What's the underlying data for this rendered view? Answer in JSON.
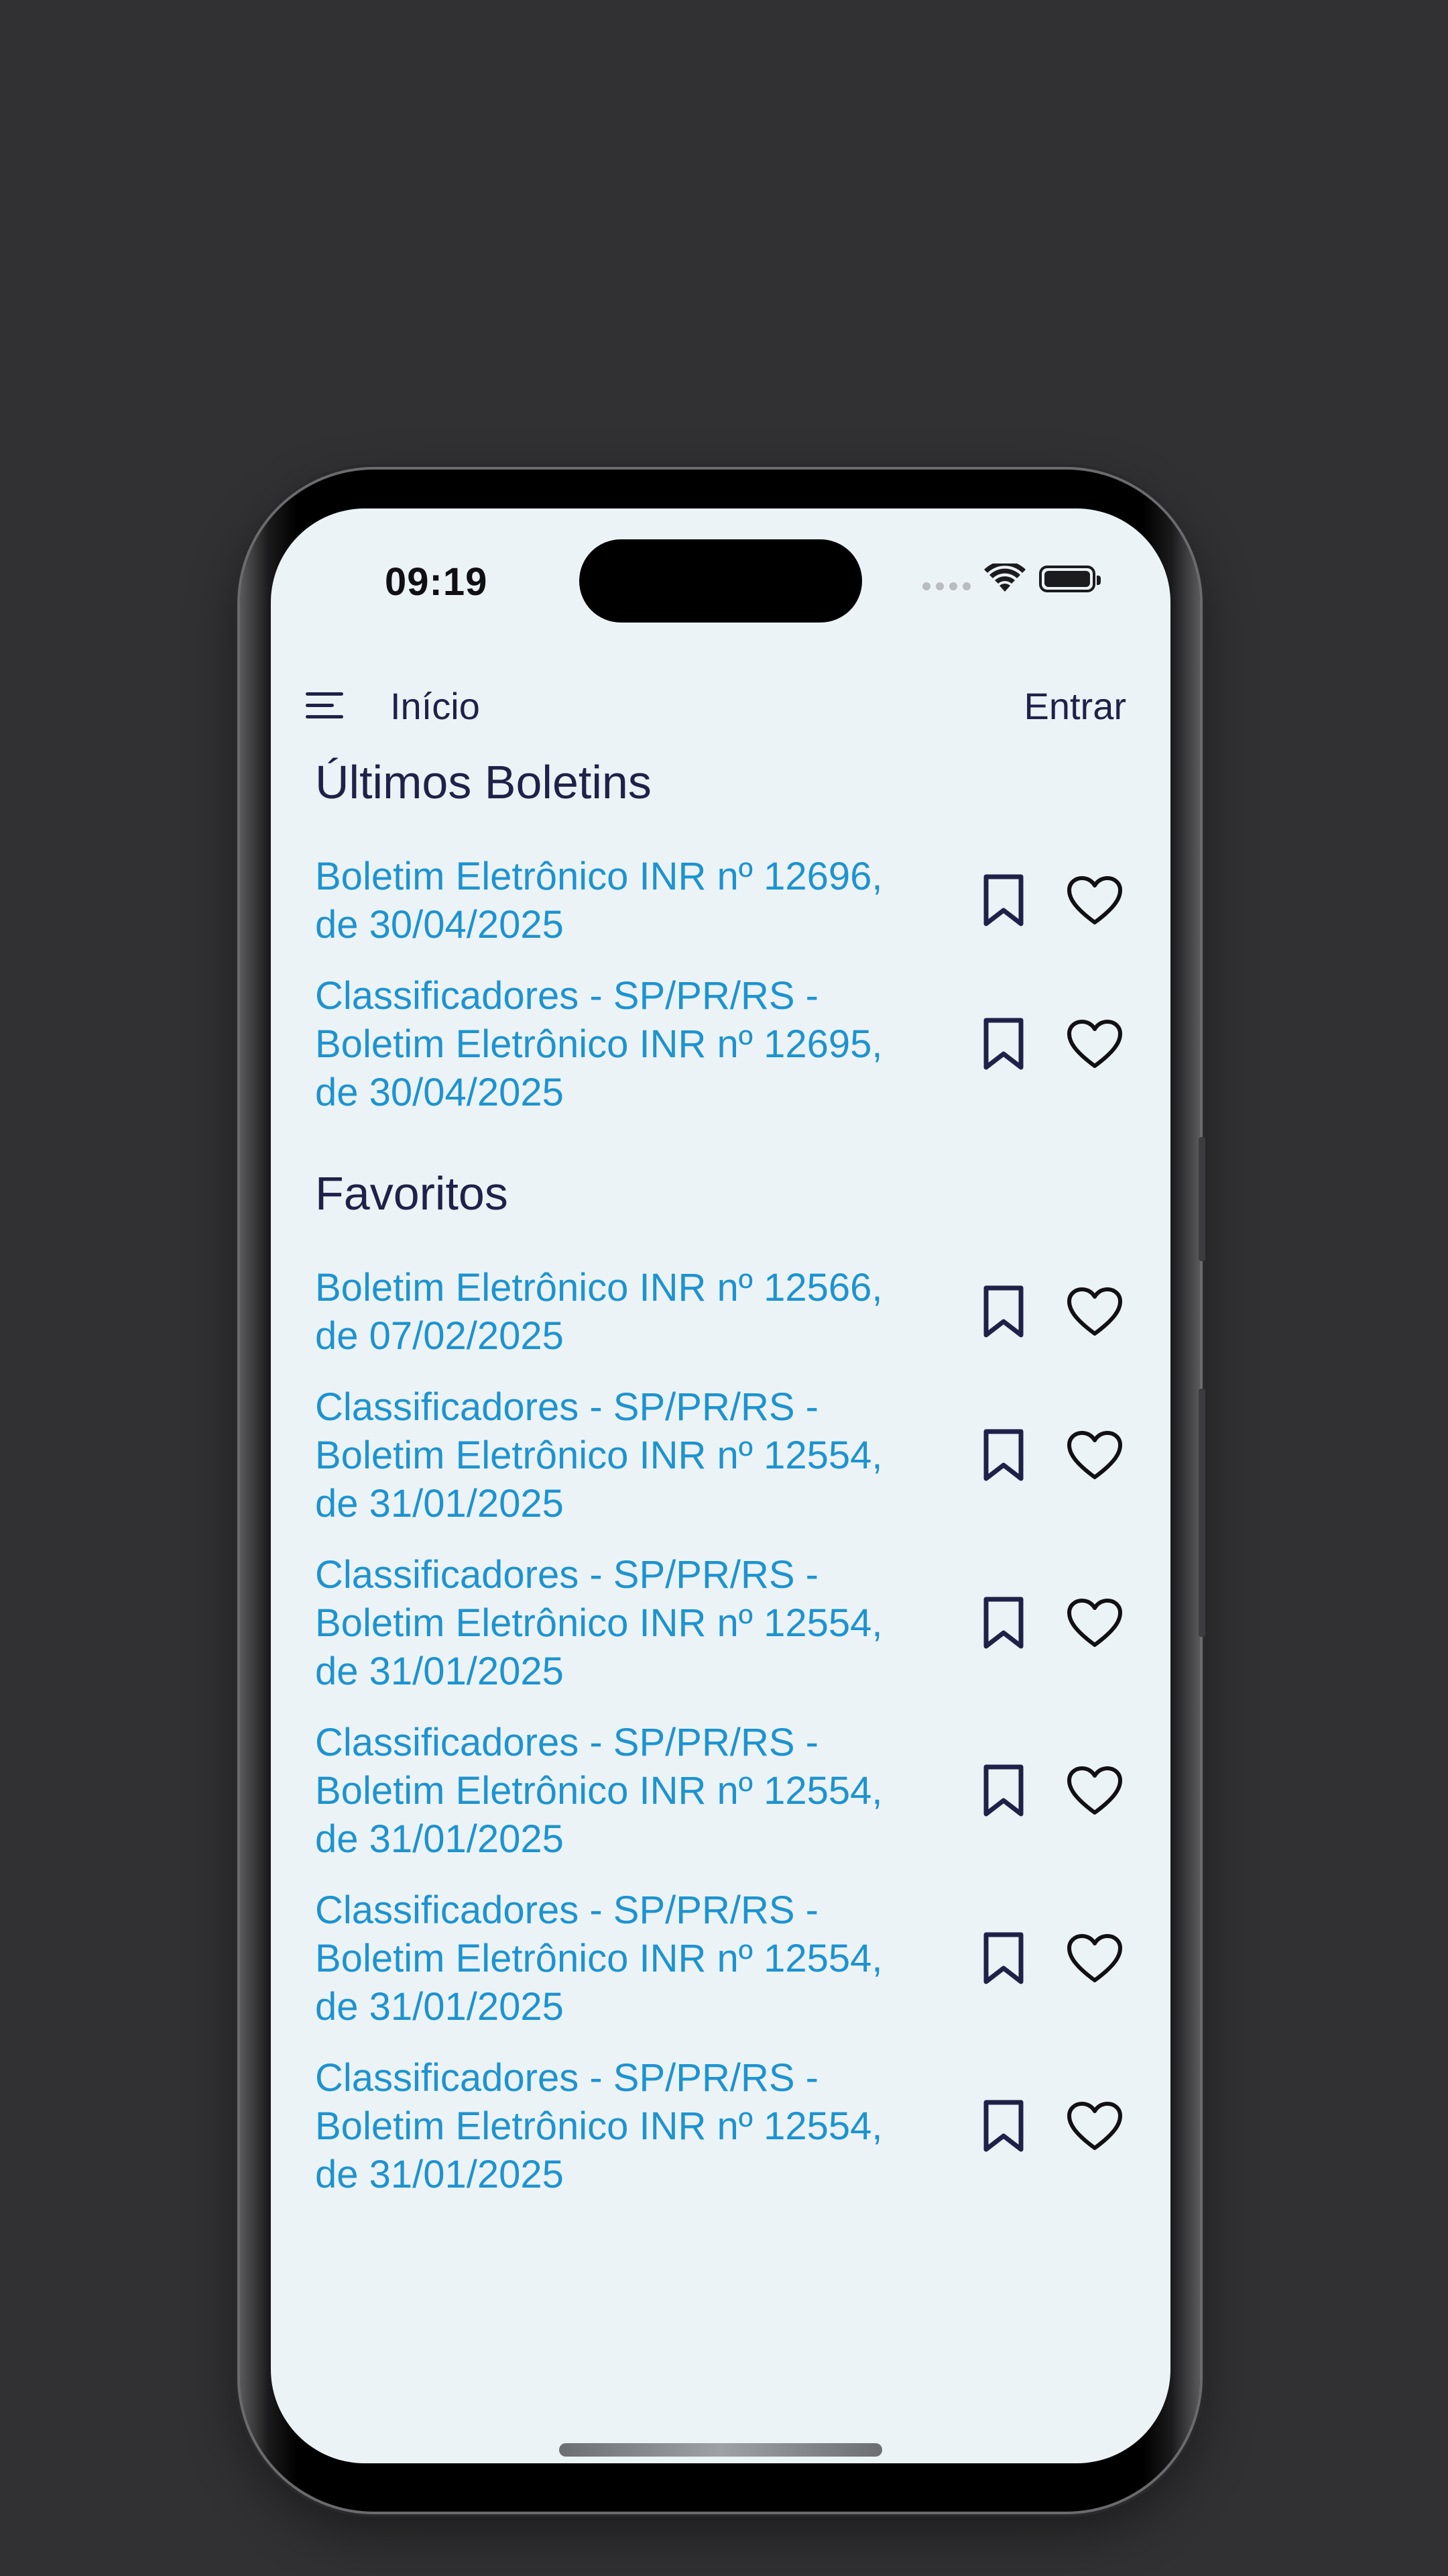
{
  "status_bar": {
    "time": "09:19"
  },
  "nav": {
    "title": "Início",
    "login_label": "Entrar",
    "menu_icon": "hamburger-menu-icon"
  },
  "sections": {
    "latest": {
      "title": "Últimos Boletins",
      "items": [
        {
          "lines": [
            "Boletim Eletrônico INR nº 12696,",
            "de 30/04/2025"
          ]
        },
        {
          "lines": [
            "Classificadores - SP/PR/RS -",
            "Boletim Eletrônico INR nº 12695,",
            "de 30/04/2025"
          ]
        }
      ]
    },
    "favorites": {
      "title": "Favoritos",
      "items": [
        {
          "lines": [
            "Boletim Eletrônico INR nº 12566,",
            "de 07/02/2025"
          ]
        },
        {
          "lines": [
            "Classificadores - SP/PR/RS -",
            "Boletim Eletrônico INR nº 12554,",
            "de 31/01/2025"
          ]
        },
        {
          "lines": [
            "Classificadores - SP/PR/RS -",
            "Boletim Eletrônico INR nº 12554,",
            "de 31/01/2025"
          ]
        },
        {
          "lines": [
            "Classificadores - SP/PR/RS -",
            "Boletim Eletrônico INR nº 12554,",
            "de 31/01/2025"
          ]
        },
        {
          "lines": [
            "Classificadores - SP/PR/RS -",
            "Boletim Eletrônico INR nº 12554,",
            "de 31/01/2025"
          ]
        },
        {
          "lines": [
            "Classificadores - SP/PR/RS -",
            "Boletim Eletrônico INR nº 12554,",
            "de 31/01/2025"
          ]
        }
      ]
    }
  },
  "icons": {
    "bookmark": "bookmark-icon",
    "heart": "heart-icon"
  },
  "colors": {
    "background": "#313133",
    "screen": "#ecf3f7",
    "link": "#1d93d0",
    "heading": "#202148"
  }
}
